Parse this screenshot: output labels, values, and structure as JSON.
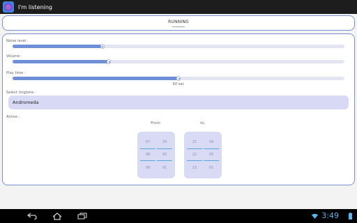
{
  "app": {
    "title": "I'm listening",
    "icon": "app-icon"
  },
  "status_banner": {
    "label": "RUNNING"
  },
  "settings": {
    "noise": {
      "label": "Noise level :",
      "level": 0.27
    },
    "volume": {
      "label": "Volume :",
      "level": 0.29
    },
    "playtime": {
      "label": "Play time :",
      "level": 0.5,
      "value": "60 sec"
    },
    "ringtone": {
      "label": "Select ringtone :",
      "value": "Andromeda"
    },
    "active": {
      "label": "Active :",
      "from": {
        "label": "From",
        "hours": [
          "07",
          "08",
          "09"
        ],
        "minutes": [
          "29",
          "00",
          "01"
        ]
      },
      "to": {
        "label": "to",
        "hours": [
          "21",
          "22",
          "23"
        ],
        "minutes": [
          "59",
          "00",
          "01"
        ]
      }
    }
  },
  "system": {
    "time": "3:49",
    "icons": [
      "back-icon",
      "home-icon",
      "recent-apps-icon",
      "wifi-icon",
      "battery-icon"
    ],
    "accent": "#5ab5e8"
  },
  "colors": {
    "slider_fill": "#6f8fd6",
    "panel_border": "#7b8fd4",
    "picker_bg": "#d9dbf5"
  }
}
